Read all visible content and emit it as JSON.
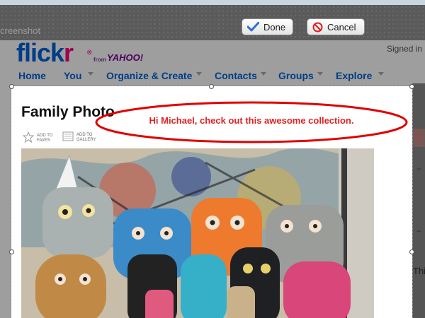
{
  "window": {
    "title": "creenshot"
  },
  "toolbar": {
    "done_label": "Done",
    "cancel_label": "Cancel"
  },
  "site": {
    "logo_flick": "flick",
    "logo_r": "r",
    "logo_reg": "®",
    "from": "from",
    "yahoo": "YAHOO!",
    "signed_in": "Signed in"
  },
  "nav": {
    "items": [
      {
        "label": "Home"
      },
      {
        "label": "You"
      },
      {
        "label": "Organize & Create"
      },
      {
        "label": "Contacts"
      },
      {
        "label": "Groups"
      },
      {
        "label": "Explore"
      }
    ]
  },
  "photo": {
    "title": "Family Photo",
    "add_to_faves": [
      "ADD TO",
      "FAVES"
    ],
    "add_to_gallery": [
      "ADD TO",
      "GALLERY"
    ]
  },
  "annotation": {
    "text": "Hi Michael, check out this awesome collection."
  },
  "right_column": {
    "partial_text": "Thi"
  },
  "colors": {
    "flickr_blue": "#0063dc",
    "flickr_pink": "#ff0084",
    "annotation_red": "#e02222"
  }
}
